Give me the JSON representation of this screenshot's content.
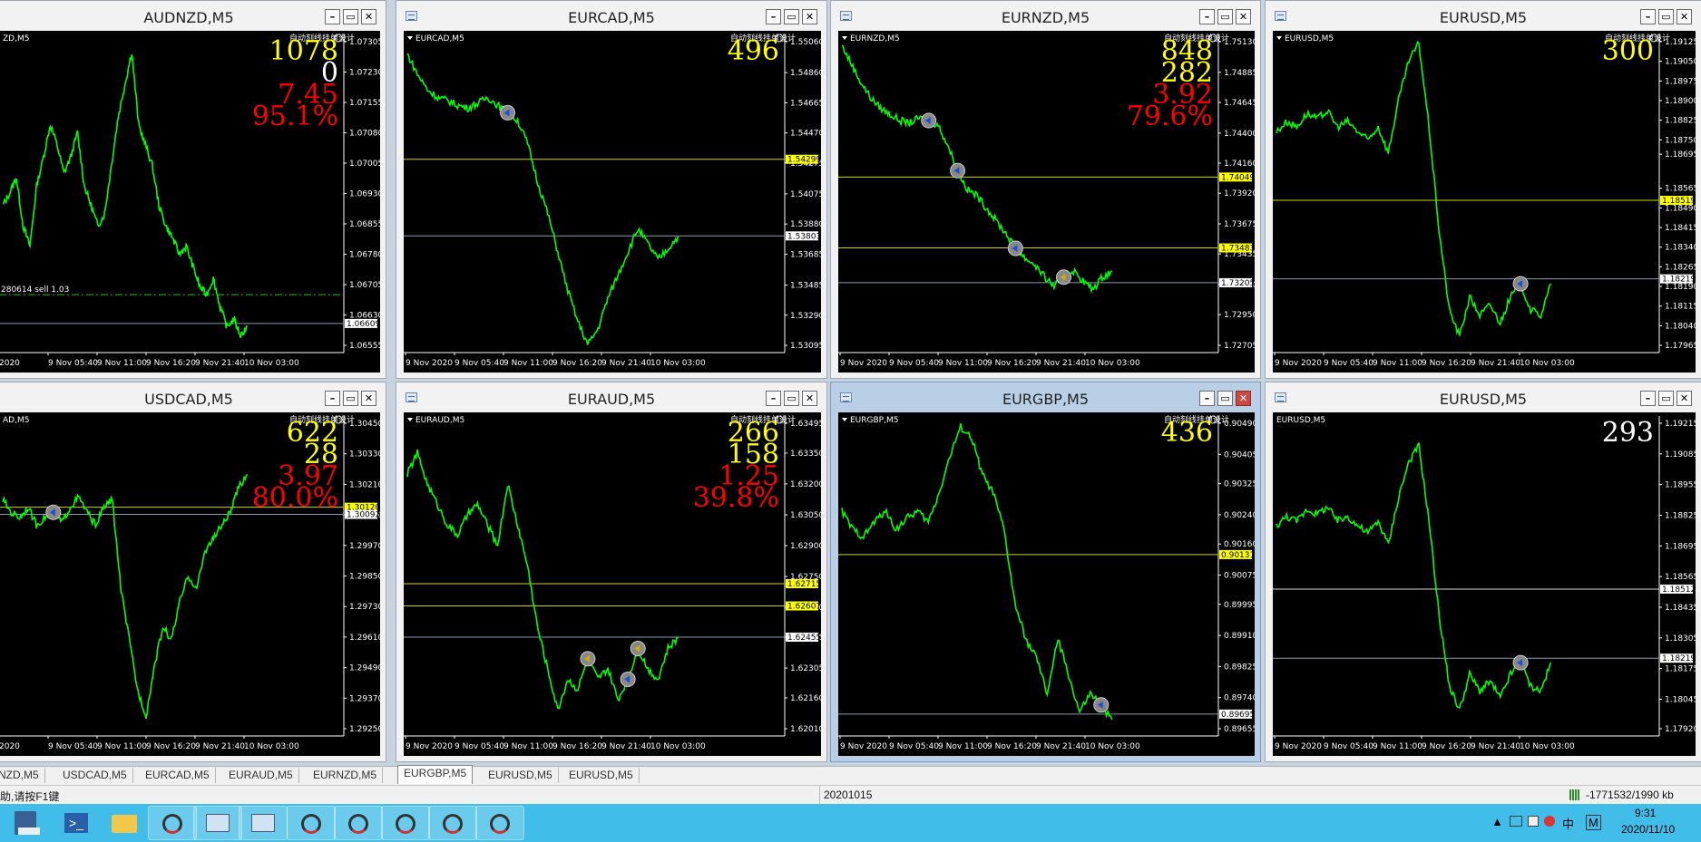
{
  "colors": {
    "bg": "#000000",
    "line": "#00ff00",
    "grid_text": "#ffffff",
    "counter_yellow": "#ffff00",
    "counter_red": "#ff0000",
    "hline_yellow": "#d6d600",
    "hline_grey": "#8c9ab0",
    "tag_yellow_bg": "#ffff00"
  },
  "charts": [
    {
      "title": "AUDNZD,M5",
      "label": "ZD,M5",
      "status_icon": "smiley-icon",
      "ea_text": "自动刻线挂单设计",
      "counters": [
        {
          "text": "1078",
          "color": "yellow"
        },
        {
          "text": "0",
          "color": "white"
        },
        {
          "text": "7.45",
          "color": "red"
        },
        {
          "text": "95.1%",
          "color": "red"
        }
      ],
      "y_ticks": [
        "1.07305",
        "1.07230",
        "1.07155",
        "1.07080",
        "1.07005",
        "1.06930",
        "1.06855",
        "1.06780",
        "1.06705",
        "1.06630",
        "1.06555"
      ],
      "x_ticks": [
        "2020",
        "9 Nov 05:40",
        "9 Nov 11:00",
        "9 Nov 16:20",
        "9 Nov 21:40",
        "10 Nov 03:00"
      ],
      "hlines": [
        {
          "price": 1.06609,
          "tag": "1.06609",
          "style": "grey"
        }
      ],
      "order_text": "280614 sell 1.03",
      "order_price": 1.0668,
      "series": [
        1.069,
        1.0693,
        1.0697,
        1.0685,
        1.068,
        1.0695,
        1.0702,
        1.071,
        1.0705,
        1.0698,
        1.0702,
        1.0708,
        1.0695,
        1.069,
        1.0685,
        1.0688,
        1.07,
        1.0712,
        1.072,
        1.0728,
        1.071,
        1.0705,
        1.07,
        1.069,
        1.0685,
        1.0682,
        1.0678,
        1.068,
        1.0675,
        1.067,
        1.0668,
        1.0672,
        1.0665,
        1.066,
        1.0662,
        1.0658,
        1.066
      ],
      "markers": []
    },
    {
      "title": "EURCAD,M5",
      "label": "EURCAD,M5",
      "status_icon": "smiley-icon",
      "ea_text": "自动刻线挂单设计",
      "counters": [
        {
          "text": "496",
          "color": "yellow"
        }
      ],
      "y_ticks": [
        "1.55060",
        "1.54860",
        "1.54665",
        "1.54470",
        "1.54275",
        "1.54075",
        "1.53880",
        "1.53685",
        "1.53485",
        "1.53290",
        "1.53095"
      ],
      "x_ticks": [
        "9 Nov 2020",
        "9 Nov 05:40",
        "9 Nov 11:00",
        "9 Nov 16:20",
        "9 Nov 21:40",
        "10 Nov 03:00"
      ],
      "hlines": [
        {
          "price": 1.54299,
          "tag": "1.54299",
          "style": "yellow"
        },
        {
          "price": 1.53803,
          "tag": "1.53803",
          "style": "grey"
        }
      ],
      "series": [
        1.5498,
        1.5485,
        1.5475,
        1.547,
        1.5468,
        1.5465,
        1.5463,
        1.5466,
        1.547,
        1.5465,
        1.546,
        1.5455,
        1.544,
        1.5415,
        1.5395,
        1.537,
        1.5345,
        1.5325,
        1.531,
        1.532,
        1.534,
        1.5355,
        1.537,
        1.5385,
        1.5375,
        1.5365,
        1.5372,
        1.538
      ],
      "markers": [
        {
          "i": 10,
          "kind": "sell"
        }
      ]
    },
    {
      "title": "EURNZD,M5",
      "label": "EURNZD,M5",
      "status_icon": "smiley-icon",
      "ea_text": "自动刻线挂单设计",
      "counters": [
        {
          "text": "848",
          "color": "yellow"
        },
        {
          "text": "282",
          "color": "yellow"
        },
        {
          "text": "3.92",
          "color": "red"
        },
        {
          "text": "79.6%",
          "color": "red"
        }
      ],
      "y_ticks": [
        "1.75130",
        "1.74885",
        "1.74645",
        "1.74400",
        "1.74160",
        "1.73920",
        "1.73675",
        "1.73435",
        "1.73190",
        "1.72950",
        "1.72705"
      ],
      "x_ticks": [
        "9 Nov 2020",
        "9 Nov 05:40",
        "9 Nov 11:00",
        "9 Nov 16:20",
        "9 Nov 21:40",
        "10 Nov 03:00"
      ],
      "hlines": [
        {
          "price": 1.74049,
          "tag": "1.74049",
          "style": "yellow"
        },
        {
          "price": 1.73483,
          "tag": "1.73483",
          "style": "yellow"
        },
        {
          "price": 1.73205,
          "tag": "1.73205",
          "style": "grey"
        }
      ],
      "series": [
        1.751,
        1.7495,
        1.748,
        1.7468,
        1.746,
        1.7455,
        1.745,
        1.7448,
        1.7452,
        1.745,
        1.7446,
        1.743,
        1.741,
        1.7395,
        1.739,
        1.738,
        1.737,
        1.736,
        1.7348,
        1.734,
        1.7335,
        1.7325,
        1.7318,
        1.7325,
        1.733,
        1.7322,
        1.7315,
        1.7325,
        1.733
      ],
      "markers": [
        {
          "i": 9,
          "kind": "sell"
        },
        {
          "i": 12,
          "kind": "sell"
        },
        {
          "i": 18,
          "kind": "sell"
        },
        {
          "i": 23,
          "kind": "buy"
        }
      ]
    },
    {
      "title": "EURUSD,M5",
      "label": "EURUSD,M5",
      "status_icon": "smiley-icon",
      "ea_text": "自动刻线挂单设计",
      "counters": [
        {
          "text": "300",
          "color": "yellow"
        }
      ],
      "y_ticks": [
        "1.19125",
        "1.19050",
        "1.18975",
        "1.18900",
        "1.18825",
        "1.18750",
        "1.18695",
        "1.18565",
        "1.18490",
        "1.18415",
        "1.18340",
        "1.18265",
        "1.18190",
        "1.18115",
        "1.18040",
        "1.17965"
      ],
      "x_ticks": [
        "9 Nov 2020",
        "9 Nov 05:40",
        "9 Nov 11:00",
        "9 Nov 16:20",
        "9 Nov 21:40",
        "10 Nov 03:00"
      ],
      "hlines": [
        {
          "price": 1.18519,
          "tag": "1.18519",
          "style": "yellow"
        },
        {
          "price": 1.18219,
          "tag": "1.18219",
          "style": "grey"
        }
      ],
      "series": [
        1.1878,
        1.1882,
        1.188,
        1.1885,
        1.1883,
        1.1886,
        1.188,
        1.1882,
        1.1878,
        1.1875,
        1.188,
        1.187,
        1.189,
        1.1905,
        1.1912,
        1.188,
        1.184,
        1.181,
        1.18,
        1.1815,
        1.1808,
        1.1812,
        1.1805,
        1.1815,
        1.182,
        1.181,
        1.1808,
        1.182
      ],
      "markers": [
        {
          "i": 24,
          "kind": "sell"
        }
      ]
    },
    {
      "title": "USDCAD,M5",
      "label": "AD,M5",
      "status_icon": "smiley-icon",
      "ea_text": "自动刻线挂单设计",
      "counters": [
        {
          "text": "622",
          "color": "yellow"
        },
        {
          "text": "28",
          "color": "yellow"
        },
        {
          "text": "3.97",
          "color": "red"
        },
        {
          "text": "80.0%",
          "color": "red"
        }
      ],
      "y_ticks": [
        "1.30450",
        "1.30330",
        "1.30210",
        "1.30090",
        "1.29970",
        "1.29850",
        "1.29730",
        "1.29610",
        "1.29490",
        "1.29370",
        "1.29250"
      ],
      "x_ticks": [
        "2020",
        "9 Nov 05:40",
        "9 Nov 11:00",
        "9 Nov 16:20",
        "9 Nov 21:40",
        "10 Nov 03:00"
      ],
      "hlines": [
        {
          "price": 1.3012,
          "tag": "1.30120",
          "style": "yellow"
        },
        {
          "price": 1.30092,
          "tag": "1.30092",
          "style": "grey"
        }
      ],
      "series": [
        1.3015,
        1.301,
        1.3008,
        1.3012,
        1.3005,
        1.3008,
        1.301,
        1.3006,
        1.3012,
        1.3016,
        1.301,
        1.3005,
        1.3012,
        1.3015,
        1.298,
        1.296,
        1.294,
        1.293,
        1.295,
        1.2965,
        1.296,
        1.2975,
        1.2985,
        1.298,
        1.2995,
        1.3,
        1.3005,
        1.301,
        1.302,
        1.3025
      ],
      "markers": [
        {
          "i": 6,
          "kind": "sell"
        }
      ]
    },
    {
      "title": "EURAUD,M5",
      "label": "EURAUD,M5",
      "status_icon": "smiley-icon",
      "ea_text": "自动刻线挂单设计",
      "counters": [
        {
          "text": "266",
          "color": "yellow"
        },
        {
          "text": "158",
          "color": "yellow"
        },
        {
          "text": "1.25",
          "color": "red"
        },
        {
          "text": "39.8%",
          "color": "red"
        }
      ],
      "y_ticks": [
        "1.63495",
        "1.63350",
        "1.63200",
        "1.63050",
        "1.62900",
        "1.62750",
        "1.62600",
        "1.62455",
        "1.62305",
        "1.62160",
        "1.62010"
      ],
      "x_ticks": [
        "9 Nov 2020",
        "9 Nov 05:40",
        "9 Nov 11:00",
        "9 Nov 16:20",
        "9 Nov 21:40",
        "10 Nov 03:00"
      ],
      "hlines": [
        {
          "price": 1.62715,
          "tag": "1.62715",
          "style": "yellow"
        },
        {
          "price": 1.62607,
          "tag": "1.62607",
          "style": "yellow"
        },
        {
          "price": 1.62455,
          "tag": "1.62455",
          "style": "grey"
        }
      ],
      "series": [
        1.6325,
        1.6335,
        1.632,
        1.631,
        1.63,
        1.6295,
        1.6305,
        1.631,
        1.63,
        1.629,
        1.632,
        1.63,
        1.628,
        1.625,
        1.623,
        1.621,
        1.6225,
        1.622,
        1.6235,
        1.6225,
        1.623,
        1.6215,
        1.6225,
        1.624,
        1.623,
        1.6225,
        1.624,
        1.6245
      ],
      "markers": [
        {
          "i": 18,
          "kind": "buy"
        },
        {
          "i": 22,
          "kind": "sell"
        },
        {
          "i": 23,
          "kind": "buy"
        }
      ]
    },
    {
      "title": "EURGBP,M5",
      "label": "EURGBP,M5",
      "status_icon": "smiley-icon",
      "ea_text": "自动刻线挂单设计",
      "counters": [
        {
          "text": "436",
          "color": "yellow"
        }
      ],
      "y_ticks": [
        "0.90490",
        "0.90405",
        "0.90325",
        "0.90240",
        "0.90160",
        "0.90075",
        "0.89995",
        "0.89910",
        "0.89825",
        "0.89740",
        "0.89655"
      ],
      "x_ticks": [
        "9 Nov 2020",
        "9 Nov 05:40",
        "9 Nov 11:00",
        "9 Nov 16:20",
        "9 Nov 21:40",
        "10 Nov 03:00"
      ],
      "hlines": [
        {
          "price": 0.90131,
          "tag": "0.90131",
          "style": "yellow"
        },
        {
          "price": 0.89695,
          "tag": "0.89695",
          "style": "grey"
        }
      ],
      "series": [
        0.9025,
        0.902,
        0.9018,
        0.9022,
        0.9025,
        0.902,
        0.9023,
        0.9025,
        0.9022,
        0.903,
        0.904,
        0.9048,
        0.9045,
        0.9035,
        0.903,
        0.902,
        0.9,
        0.899,
        0.8985,
        0.8975,
        0.899,
        0.898,
        0.897,
        0.8975,
        0.8972,
        0.8968
      ],
      "markers": [
        {
          "i": 24,
          "kind": "sell"
        }
      ]
    },
    {
      "title": "EURUSD,M5",
      "label": "EURUSD,M5",
      "status_icon": "",
      "ea_text": "",
      "counters": [
        {
          "text": "293",
          "color": "white"
        }
      ],
      "y_ticks": [
        "1.19215",
        "1.19085",
        "1.18955",
        "1.18825",
        "1.18695",
        "1.18565",
        "1.18435",
        "1.18305",
        "1.18175",
        "1.18045",
        "1.17920"
      ],
      "x_ticks": [
        "9 Nov 2020",
        "9 Nov 05:40",
        "9 Nov 11:00",
        "9 Nov 16:20",
        "9 Nov 21:40",
        "10 Nov 03:00"
      ],
      "hlines": [
        {
          "price": 1.18512,
          "tag": "1.18512",
          "style": "white"
        },
        {
          "price": 1.18219,
          "tag": "1.18219",
          "style": "grey"
        }
      ],
      "series": [
        1.1878,
        1.1882,
        1.188,
        1.1885,
        1.1883,
        1.1886,
        1.188,
        1.1882,
        1.1878,
        1.1875,
        1.188,
        1.187,
        1.189,
        1.1905,
        1.1912,
        1.188,
        1.184,
        1.181,
        1.18,
        1.1815,
        1.1808,
        1.1812,
        1.1805,
        1.1815,
        1.182,
        1.181,
        1.1808,
        1.182
      ],
      "markers": [
        {
          "i": 24,
          "kind": "sell"
        }
      ]
    }
  ],
  "tabs": [
    "NZD,M5",
    "USDCAD,M5",
    "EURCAD,M5",
    "EURAUD,M5",
    "EURNZD,M5",
    "EURGBP,M5",
    "EURUSD,M5",
    "EURUSD,M5"
  ],
  "active_tab": "EURGBP,M5",
  "status": {
    "help": "助,请按F1键",
    "date": "20201015",
    "traffic": "-1771532/1990 kb"
  },
  "taskbar": {
    "time": "9:31",
    "date": "2020/11/10",
    "ime_lang": "中",
    "ime_mode": "M"
  }
}
